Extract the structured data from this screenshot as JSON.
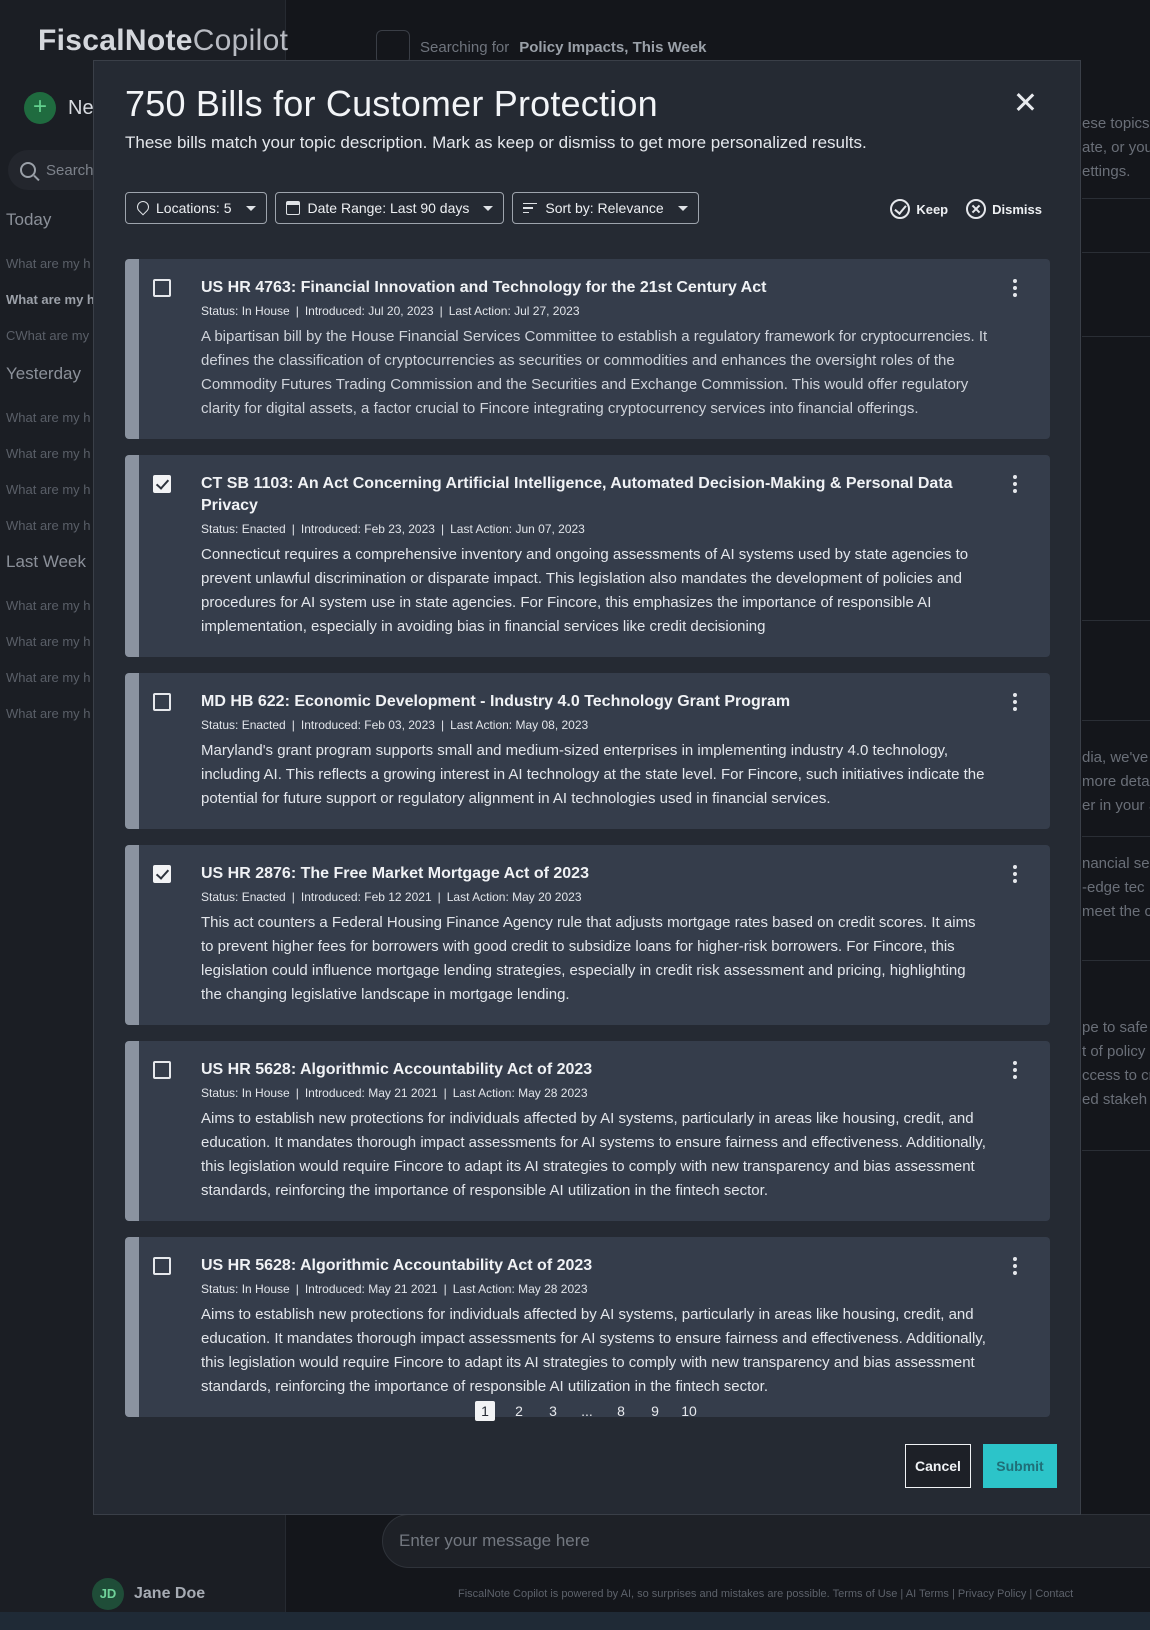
{
  "app": {
    "logo_bold": "FiscalNote",
    "logo_light": "Copilot",
    "new_label": "Ne",
    "search_placeholder": "Search",
    "top_prefix": "Searching for",
    "top_topic": "Policy Impacts, This Week",
    "input_placeholder": "Enter your message here",
    "footer": "FiscalNote Copilot is powered by AI, so surprises and mistakes are possible. Terms of Use | AI Terms | Privacy Policy | Contact",
    "user_initials": "JD",
    "user_name": "Jane Doe",
    "right_peek": [
      "ese topics",
      "ate, or you",
      "ettings.",
      "dia, we've",
      "more deta",
      "er in your S",
      "nancial ser",
      "-edge tec",
      "meet the c",
      "pe to safe",
      "t of policy",
      "ccess to cr",
      "ed stakeh"
    ]
  },
  "sidebar": {
    "groups": [
      {
        "label": "Today",
        "items": [
          "What are my h",
          "What are my h",
          "CWhat are my"
        ]
      },
      {
        "label": "Yesterday",
        "items": [
          "What are my h",
          "What are my h",
          "What are my h",
          "What are my h"
        ]
      },
      {
        "label": "Last Week",
        "items": [
          "What are my h",
          "What are my h",
          "What are my h",
          "What are my h"
        ]
      }
    ]
  },
  "modal": {
    "title": "750 Bills for Customer Protection",
    "subtitle": "These bills match your topic description. Mark as keep or dismiss to get more personalized results.",
    "filters": {
      "locations": "Locations: 5",
      "date_range": "Date Range: Last 90 days",
      "sort": "Sort by: Relevance"
    },
    "keep_label": "Keep",
    "dismiss_label": "Dismiss",
    "cancel_label": "Cancel",
    "submit_label": "Submit",
    "pages": [
      "1",
      "2",
      "3",
      "...",
      "8",
      "9",
      "10"
    ],
    "current_page": "1"
  },
  "bills": [
    {
      "title": "US HR 4763: Financial Innovation and Technology for the 21st Century Act",
      "status": "Status: In House",
      "introduced": "Introduced: Jul 20, 2023",
      "last_action": "Last Action: Jul 27, 2023",
      "checked": false,
      "description": "A bipartisan bill by the House Financial Services Committee to establish a regulatory framework for cryptocurrencies. It defines the classification of cryptocurrencies as securities or commodities and enhances the oversight roles of the Commodity Futures Trading Commission and the Securities and Exchange Commission. This would offer regulatory clarity for digital assets, a factor crucial to Fincore integrating cryptocurrency services into financial offerings."
    },
    {
      "title": "CT SB 1103: An Act Concerning Artificial Intelligence, Automated Decision-Making & Personal Data Privacy",
      "status": "Status: Enacted",
      "introduced": "Introduced: Feb 23, 2023",
      "last_action": "Last Action: Jun 07, 2023",
      "checked": true,
      "description": "Connecticut requires a comprehensive inventory and ongoing assessments of AI systems used by state agencies to prevent unlawful discrimination or disparate impact. This legislation also mandates the development of policies and procedures for AI system use in state agencies. For Fincore, this emphasizes the importance of responsible AI implementation, especially in avoiding bias in financial services like credit decisioning"
    },
    {
      "title": "MD HB 622: Economic Development - Industry 4.0 Technology Grant Program",
      "status": "Status: Enacted",
      "introduced": "Introduced: Feb 03, 2023",
      "last_action": "Last Action: May 08, 2023",
      "checked": false,
      "description": "Maryland's grant program supports small and medium-sized enterprises in implementing industry 4.0 technology, including AI. This reflects a growing interest in AI technology at the state level. For Fincore, such initiatives indicate the potential for future support or regulatory alignment in AI technologies used in financial services."
    },
    {
      "title": "US HR 2876: The Free Market Mortgage Act of 2023",
      "status": "Status: Enacted",
      "introduced": "Introduced: Feb 12 2021",
      "last_action": "Last Action: May 20 2023",
      "checked": true,
      "description": "This act counters a Federal Housing Finance Agency rule that adjusts mortgage rates based on credit scores. It aims to prevent higher fees for borrowers with good credit to subsidize loans for higher-risk borrowers. For Fincore, this legislation could influence mortgage lending strategies, especially in credit risk assessment and pricing, highlighting the changing legislative landscape in mortgage lending."
    },
    {
      "title": "US HR 5628: Algorithmic Accountability Act of 2023",
      "status": "Status: In House",
      "introduced": "Introduced: May 21 2021",
      "last_action": "Last Action: May 28 2023",
      "checked": false,
      "description": "Aims to establish new protections for individuals affected by AI systems, particularly in areas like housing, credit, and education. It mandates thorough impact assessments for AI systems to ensure fairness and effectiveness. Additionally, this legislation would require Fincore to adapt its AI strategies to comply with new transparency and bias assessment standards, reinforcing the importance of responsible AI utilization in the fintech sector."
    },
    {
      "title": "US HR 5628: Algorithmic Accountability Act of 2023",
      "status": "Status: In House",
      "introduced": "Introduced: May 21 2021",
      "last_action": "Last Action: May 28 2023",
      "checked": false,
      "description": "Aims to establish new protections for individuals affected by AI systems, particularly in areas like housing, credit, and education. It mandates thorough impact assessments for AI systems to ensure fairness and effectiveness. Additionally, this legislation would require Fincore to adapt its AI strategies to comply with new transparency and bias assessment standards, reinforcing the importance of responsible AI utilization in the fintech sector."
    }
  ]
}
